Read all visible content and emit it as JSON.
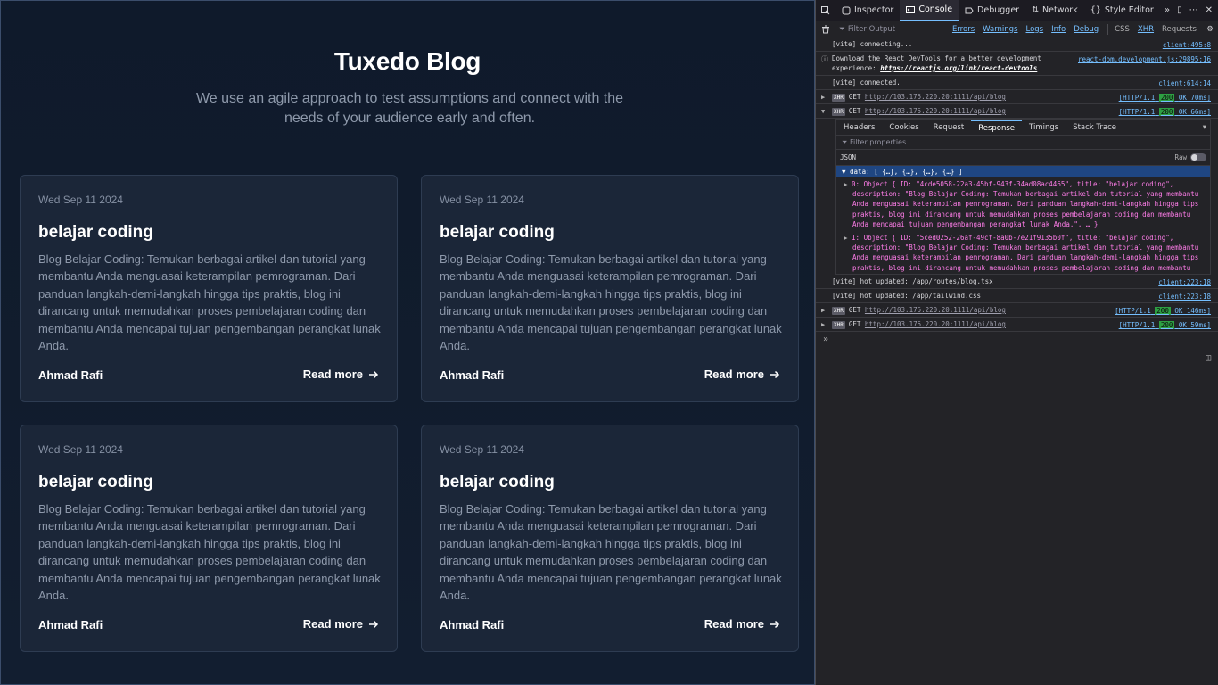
{
  "blog": {
    "title": "Tuxedo Blog",
    "subtitle": "We use an agile approach to test assumptions and connect with the needs of your audience early and often.",
    "posts": [
      {
        "date": "Wed Sep 11 2024",
        "title": "belajar coding",
        "description": "Blog Belajar Coding: Temukan berbagai artikel dan tutorial yang membantu Anda menguasai keterampilan pemrograman. Dari panduan langkah-demi-langkah hingga tips praktis, blog ini dirancang untuk memudahkan proses pembelajaran coding dan membantu Anda mencapai tujuan pengembangan perangkat lunak Anda.",
        "author": "Ahmad Rafi",
        "read_more": "Read more"
      },
      {
        "date": "Wed Sep 11 2024",
        "title": "belajar coding",
        "description": "Blog Belajar Coding: Temukan berbagai artikel dan tutorial yang membantu Anda menguasai keterampilan pemrograman. Dari panduan langkah-demi-langkah hingga tips praktis, blog ini dirancang untuk memudahkan proses pembelajaran coding dan membantu Anda mencapai tujuan pengembangan perangkat lunak Anda.",
        "author": "Ahmad Rafi",
        "read_more": "Read more"
      },
      {
        "date": "Wed Sep 11 2024",
        "title": "belajar coding",
        "description": "Blog Belajar Coding: Temukan berbagai artikel dan tutorial yang membantu Anda menguasai keterampilan pemrograman. Dari panduan langkah-demi-langkah hingga tips praktis, blog ini dirancang untuk memudahkan proses pembelajaran coding dan membantu Anda mencapai tujuan pengembangan perangkat lunak Anda.",
        "author": "Ahmad Rafi",
        "read_more": "Read more"
      },
      {
        "date": "Wed Sep 11 2024",
        "title": "belajar coding",
        "description": "Blog Belajar Coding: Temukan berbagai artikel dan tutorial yang membantu Anda menguasai keterampilan pemrograman. Dari panduan langkah-demi-langkah hingga tips praktis, blog ini dirancang untuk memudahkan proses pembelajaran coding dan membantu Anda mencapai tujuan pengembangan perangkat lunak Anda.",
        "author": "Ahmad Rafi",
        "read_more": "Read more"
      }
    ]
  },
  "devtools": {
    "tabs": [
      "Inspector",
      "Console",
      "Debugger",
      "Network",
      "Style Editor"
    ],
    "active_tab": "Console",
    "filter_placeholder": "Filter Output",
    "filter_chips": [
      "Errors",
      "Warnings",
      "Logs",
      "Info",
      "Debug"
    ],
    "extra_chips": [
      "CSS",
      "XHR",
      "Requests"
    ],
    "logs": {
      "l1_text": "[vite] connecting...",
      "l1_src": "client:495:8",
      "l2_text": "Download the React DevTools for a better development experience: ",
      "l2_link": "https://reactjs.org/link/react-devtools",
      "l2_src": "react-dom.development.js:29895:16",
      "l3_text": "[vite] connected.",
      "l3_src": "client:614:14",
      "xhr1_method": "GET",
      "xhr1_url": "http://103.175.220.20:1111/api/blog",
      "xhr1_proto": "[HTTP/1.1",
      "xhr1_code": "200",
      "xhr1_rest": "OK 70ms]",
      "xhr2_method": "GET",
      "xhr2_url": "http://103.175.220.20:1111/api/blog",
      "xhr2_proto": "[HTTP/1.1",
      "xhr2_code": "200",
      "xhr2_rest": "OK 66ms]",
      "hot1_text": "[vite] hot updated: /app/routes/blog.tsx",
      "hot1_src": "client:223:18",
      "hot2_text": "[vite] hot updated: /app/tailwind.css",
      "hot2_src": "client:223:18",
      "xhr3_method": "GET",
      "xhr3_url": "http://103.175.220.20:1111/api/blog",
      "xhr3_proto": "[HTTP/1.1",
      "xhr3_code": "200",
      "xhr3_rest": "OK 146ms]",
      "xhr4_method": "GET",
      "xhr4_url": "http://103.175.220.20:1111/api/blog",
      "xhr4_proto": "[HTTP/1.1",
      "xhr4_code": "200",
      "xhr4_rest": "OK 59ms]"
    },
    "xhr_tag": "XHR",
    "xhr_subtabs": [
      "Headers",
      "Cookies",
      "Request",
      "Response",
      "Timings",
      "Stack Trace"
    ],
    "xhr_active_subtab": "Response",
    "filter_properties": "Filter properties",
    "json_label": "JSON",
    "raw_label": "Raw",
    "json_root": "data: [ {…}, {…}, {…}, {…} ]",
    "obj0": "0: Object { ID: \"4cde5058-22a3-45bf-943f-34ad08ac4465\", title: \"belajar coding\", description: \"Blog Belajar Coding: Temukan berbagai artikel dan tutorial yang membantu Anda menguasai keterampilan pemrograman. Dari panduan langkah-demi-langkah hingga tips praktis, blog ini dirancang untuk memudahkan proses pembelajaran coding dan membantu Anda mencapai tujuan pengembangan perangkat lunak Anda.\", … }",
    "obj1": "1: Object { ID: \"5ced0252-26af-49cf-8a0b-7e21f9135b0f\", title: \"belajar coding\", description: \"Blog Belajar Coding: Temukan berbagai artikel dan tutorial yang membantu Anda menguasai keterampilan pemrograman. Dari panduan langkah-demi-langkah hingga tips praktis, blog ini dirancang untuk memudahkan proses pembelajaran coding dan membantu Anda mencapai tujuan pengembangan perangkat lunak"
  },
  "colors": {
    "page_bg": "#0f1a2b",
    "card_bg": "#1b2638",
    "devtools_bg": "#232327",
    "accent_blue": "#75bfff",
    "status_green": "#2ea043"
  }
}
